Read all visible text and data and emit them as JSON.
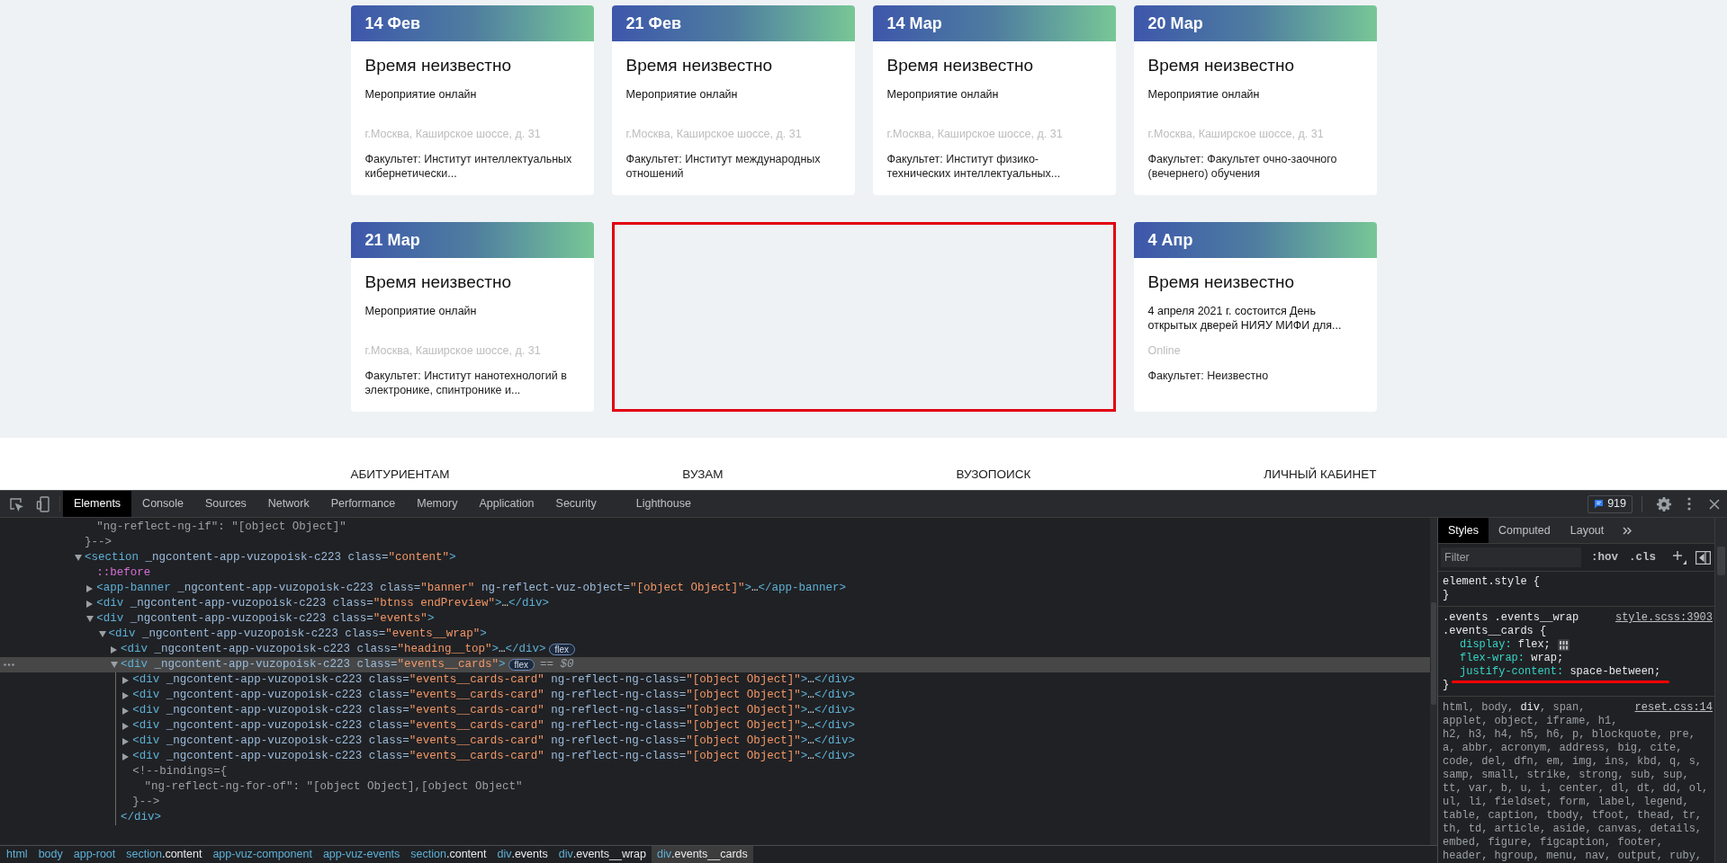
{
  "page": {
    "cards": [
      {
        "kind": "event",
        "date": "14 Фев",
        "time": "Время неизвестно",
        "description": "Мероприятие онлайн",
        "address": "г.Москва, Каширское шоссе, д. 31",
        "faculty": "Факультет: Институт интеллектуальных кибернетически..."
      },
      {
        "kind": "event",
        "date": "21 Фев",
        "time": "Время неизвестно",
        "description": "Мероприятие онлайн",
        "address": "г.Москва, Каширское шоссе, д. 31",
        "faculty": "Факультет: Институт международных отношений"
      },
      {
        "kind": "event",
        "date": "14 Мар",
        "time": "Время неизвестно",
        "description": "Мероприятие онлайн",
        "address": "г.Москва, Каширское шоссе, д. 31",
        "faculty": "Факультет: Институт физико-технических интеллектуальных..."
      },
      {
        "kind": "event",
        "date": "20 Мар",
        "time": "Время неизвестно",
        "description": "Мероприятие онлайн",
        "address": "г.Москва, Каширское шоссе, д. 31",
        "faculty": "Факультет: Факультет очно-заочного (вечернего) обучения"
      },
      {
        "kind": "event",
        "date": "21 Мар",
        "time": "Время неизвестно",
        "description": "Мероприятие онлайн",
        "address": "г.Москва, Каширское шоссе, д. 31",
        "faculty": "Факультет: Институт нанотехнологий в электронике, спинтронике и..."
      },
      {
        "kind": "highlight"
      },
      {
        "kind": "event",
        "date": "4 Апр",
        "time": "Время неизвестно",
        "description": "4 апреля 2021 г. состоится День открытых дверей НИЯУ МИФИ для...",
        "address": "Online",
        "faculty": "Факультет: Неизвестно"
      }
    ],
    "footer_nav": [
      "АБИТУРИЕНТАМ",
      "ВУЗАМ",
      "ВУЗОПОИСК",
      "ЛИЧНЫЙ КАБИНЕТ"
    ]
  },
  "devtools": {
    "tabs": [
      {
        "label": "Elements",
        "selected": true
      },
      {
        "label": "Console",
        "selected": false
      },
      {
        "label": "Sources",
        "selected": false
      },
      {
        "label": "Network",
        "selected": false
      },
      {
        "label": "Performance",
        "selected": false
      },
      {
        "label": "Memory",
        "selected": false
      },
      {
        "label": "Application",
        "selected": false
      },
      {
        "label": "Security",
        "selected": false
      },
      {
        "label": "Lighthouse",
        "selected": false
      }
    ],
    "issues_count": "919",
    "dom_tree": [
      {
        "kind": "comment-body",
        "selected": false,
        "tokens": [
          {
            "kind": "comment",
            "text": "\"ng-reflect-ng-if\": \"[object Object]\""
          }
        ]
      },
      {
        "kind": "comment",
        "selected": false,
        "tokens": [
          {
            "kind": "comment",
            "text": "}-->"
          }
        ]
      },
      {
        "kind": "element",
        "selected": false,
        "expanded": true,
        "tokens": [
          {
            "kind": "tag",
            "text": "<section"
          },
          {
            "kind": "attr",
            "text": " _ngcontent-app-vuzopoisk-c223 class="
          },
          {
            "kind": "value",
            "text": "\"content\""
          },
          {
            "kind": "tag",
            "text": ">"
          }
        ],
        "children": [
          {
            "kind": "pseudo",
            "selected": false,
            "tokens": [
              {
                "kind": "pseudo",
                "text": "::before"
              }
            ]
          },
          {
            "kind": "element",
            "selected": false,
            "expanded": false,
            "tokens": [
              {
                "kind": "tag",
                "text": "<app-banner"
              },
              {
                "kind": "attr",
                "text": " _ngcontent-app-vuzopoisk-c223 class="
              },
              {
                "kind": "value",
                "text": "\"banner\""
              },
              {
                "kind": "attr",
                "text": " ng-reflect-vuz-object="
              },
              {
                "kind": "value",
                "text": "\"[object Object]\""
              },
              {
                "kind": "tag",
                "text": ">"
              },
              {
                "kind": "ellipsis",
                "text": "…"
              },
              {
                "kind": "tag",
                "text": "</app-banner>"
              }
            ]
          },
          {
            "kind": "element",
            "selected": false,
            "expanded": false,
            "tokens": [
              {
                "kind": "tag",
                "text": "<div"
              },
              {
                "kind": "attr",
                "text": " _ngcontent-app-vuzopoisk-c223 class="
              },
              {
                "kind": "value",
                "text": "\"btnss endPreview\""
              },
              {
                "kind": "tag",
                "text": ">"
              },
              {
                "kind": "ellipsis",
                "text": "…"
              },
              {
                "kind": "tag",
                "text": "</div>"
              }
            ]
          },
          {
            "kind": "element",
            "selected": false,
            "expanded": true,
            "tokens": [
              {
                "kind": "tag",
                "text": "<div"
              },
              {
                "kind": "attr",
                "text": " _ngcontent-app-vuzopoisk-c223 class="
              },
              {
                "kind": "value",
                "text": "\"events\""
              },
              {
                "kind": "tag",
                "text": ">"
              }
            ],
            "children": [
              {
                "kind": "element",
                "selected": false,
                "expanded": true,
                "tokens": [
                  {
                    "kind": "tag",
                    "text": "<div"
                  },
                  {
                    "kind": "attr",
                    "text": " _ngcontent-app-vuzopoisk-c223 class="
                  },
                  {
                    "kind": "value",
                    "text": "\"events__wrap\""
                  },
                  {
                    "kind": "tag",
                    "text": ">"
                  }
                ],
                "children": [
                  {
                    "kind": "element",
                    "selected": false,
                    "expanded": false,
                    "badge": "flex",
                    "tokens": [
                      {
                        "kind": "tag",
                        "text": "<div"
                      },
                      {
                        "kind": "attr",
                        "text": " _ngcontent-app-vuzopoisk-c223 class="
                      },
                      {
                        "kind": "value",
                        "text": "\"heading__top\""
                      },
                      {
                        "kind": "tag",
                        "text": ">"
                      },
                      {
                        "kind": "ellipsis",
                        "text": "…"
                      },
                      {
                        "kind": "tag",
                        "text": "</div>"
                      }
                    ]
                  },
                  {
                    "kind": "element",
                    "selected": true,
                    "expanded": true,
                    "badge": "flex",
                    "note": "== $0",
                    "close": "</div>",
                    "tokens": [
                      {
                        "kind": "tag",
                        "text": "<div"
                      },
                      {
                        "kind": "attr",
                        "text": " _ngcontent-app-vuzopoisk-c223 class="
                      },
                      {
                        "kind": "value",
                        "text": "\"events__cards\""
                      },
                      {
                        "kind": "tag",
                        "text": ">"
                      }
                    ],
                    "children": [
                      {
                        "kind": "element",
                        "selected": false,
                        "expanded": false,
                        "tokens": [
                          {
                            "kind": "tag",
                            "text": "<div"
                          },
                          {
                            "kind": "attr",
                            "text": " _ngcontent-app-vuzopoisk-c223 class="
                          },
                          {
                            "kind": "value",
                            "text": "\"events__cards-card\""
                          },
                          {
                            "kind": "attr",
                            "text": " ng-reflect-ng-class="
                          },
                          {
                            "kind": "value",
                            "text": "\"[object Object]\""
                          },
                          {
                            "kind": "tag",
                            "text": ">"
                          },
                          {
                            "kind": "ellipsis",
                            "text": "…"
                          },
                          {
                            "kind": "tag",
                            "text": "</div>"
                          }
                        ]
                      },
                      {
                        "kind": "element",
                        "selected": false,
                        "expanded": false,
                        "tokens": [
                          {
                            "kind": "tag",
                            "text": "<div"
                          },
                          {
                            "kind": "attr",
                            "text": " _ngcontent-app-vuzopoisk-c223 class="
                          },
                          {
                            "kind": "value",
                            "text": "\"events__cards-card\""
                          },
                          {
                            "kind": "attr",
                            "text": " ng-reflect-ng-class="
                          },
                          {
                            "kind": "value",
                            "text": "\"[object Object]\""
                          },
                          {
                            "kind": "tag",
                            "text": ">"
                          },
                          {
                            "kind": "ellipsis",
                            "text": "…"
                          },
                          {
                            "kind": "tag",
                            "text": "</div>"
                          }
                        ]
                      },
                      {
                        "kind": "element",
                        "selected": false,
                        "expanded": false,
                        "tokens": [
                          {
                            "kind": "tag",
                            "text": "<div"
                          },
                          {
                            "kind": "attr",
                            "text": " _ngcontent-app-vuzopoisk-c223 class="
                          },
                          {
                            "kind": "value",
                            "text": "\"events__cards-card\""
                          },
                          {
                            "kind": "attr",
                            "text": " ng-reflect-ng-class="
                          },
                          {
                            "kind": "value",
                            "text": "\"[object Object]\""
                          },
                          {
                            "kind": "tag",
                            "text": ">"
                          },
                          {
                            "kind": "ellipsis",
                            "text": "…"
                          },
                          {
                            "kind": "tag",
                            "text": "</div>"
                          }
                        ]
                      },
                      {
                        "kind": "element",
                        "selected": false,
                        "expanded": false,
                        "tokens": [
                          {
                            "kind": "tag",
                            "text": "<div"
                          },
                          {
                            "kind": "attr",
                            "text": " _ngcontent-app-vuzopoisk-c223 class="
                          },
                          {
                            "kind": "value",
                            "text": "\"events__cards-card\""
                          },
                          {
                            "kind": "attr",
                            "text": " ng-reflect-ng-class="
                          },
                          {
                            "kind": "value",
                            "text": "\"[object Object]\""
                          },
                          {
                            "kind": "tag",
                            "text": ">"
                          },
                          {
                            "kind": "ellipsis",
                            "text": "…"
                          },
                          {
                            "kind": "tag",
                            "text": "</div>"
                          }
                        ]
                      },
                      {
                        "kind": "element",
                        "selected": false,
                        "expanded": false,
                        "tokens": [
                          {
                            "kind": "tag",
                            "text": "<div"
                          },
                          {
                            "kind": "attr",
                            "text": " _ngcontent-app-vuzopoisk-c223 class="
                          },
                          {
                            "kind": "value",
                            "text": "\"events__cards-card\""
                          },
                          {
                            "kind": "attr",
                            "text": " ng-reflect-ng-class="
                          },
                          {
                            "kind": "value",
                            "text": "\"[object Object]\""
                          },
                          {
                            "kind": "tag",
                            "text": ">"
                          },
                          {
                            "kind": "ellipsis",
                            "text": "…"
                          },
                          {
                            "kind": "tag",
                            "text": "</div>"
                          }
                        ]
                      },
                      {
                        "kind": "element",
                        "selected": false,
                        "expanded": false,
                        "tokens": [
                          {
                            "kind": "tag",
                            "text": "<div"
                          },
                          {
                            "kind": "attr",
                            "text": " _ngcontent-app-vuzopoisk-c223 class="
                          },
                          {
                            "kind": "value",
                            "text": "\"events__cards-card\""
                          },
                          {
                            "kind": "attr",
                            "text": " ng-reflect-ng-class="
                          },
                          {
                            "kind": "value",
                            "text": "\"[object Object]\""
                          },
                          {
                            "kind": "tag",
                            "text": ">"
                          },
                          {
                            "kind": "ellipsis",
                            "text": "…"
                          },
                          {
                            "kind": "tag",
                            "text": "</div>"
                          }
                        ]
                      },
                      {
                        "kind": "comment",
                        "selected": false,
                        "tokens": [
                          {
                            "kind": "comment",
                            "text": "<!--bindings={"
                          }
                        ]
                      },
                      {
                        "kind": "comment-body",
                        "selected": false,
                        "tokens": [
                          {
                            "kind": "comment",
                            "text": "\"ng-reflect-ng-for-of\": \"[object Object],[object Object\""
                          }
                        ]
                      },
                      {
                        "kind": "comment",
                        "selected": false,
                        "tokens": [
                          {
                            "kind": "comment",
                            "text": "}-->"
                          }
                        ]
                      }
                    ]
                  }
                ]
              }
            ]
          }
        ]
      }
    ],
    "breadcrumbs": [
      {
        "tag": "html",
        "selected": false
      },
      {
        "tag": "body",
        "selected": false
      },
      {
        "tag": "app-root",
        "selected": false
      },
      {
        "tag": "section",
        "cls": ".content",
        "selected": false
      },
      {
        "tag": "app-vuz-component",
        "selected": false
      },
      {
        "tag": "app-vuz-events",
        "selected": false
      },
      {
        "tag": "section",
        "cls": ".content",
        "selected": false
      },
      {
        "tag": "div",
        "cls": ".events",
        "selected": false
      },
      {
        "tag": "div",
        "cls": ".events__wrap",
        "selected": false
      },
      {
        "tag": "div",
        "cls": ".events__cards",
        "selected": true
      }
    ],
    "styles": {
      "tabs": [
        {
          "label": "Styles",
          "selected": true
        },
        {
          "label": "Computed",
          "selected": false
        },
        {
          "label": "Layout",
          "selected": false
        }
      ],
      "filter": {
        "placeholder": "Filter"
      },
      "toggles": [
        ":hov",
        ".cls"
      ],
      "rules": [
        {
          "kind": "inline",
          "selector_lines": [
            "element.style {"
          ],
          "close": "}"
        },
        {
          "kind": "matched",
          "selector_lines": [
            ".events .events__wrap",
            ".events__cards {"
          ],
          "source": "style.scss:3903",
          "close": "}",
          "declarations": [
            {
              "property": "display:",
              "value": "flex;",
              "flex_editor": true,
              "underlined": false
            },
            {
              "property": "flex-wrap:",
              "value": "wrap;",
              "flex_editor": false,
              "underlined": false
            },
            {
              "property": "justify-content:",
              "value": "space-between;",
              "flex_editor": false,
              "underlined": true
            }
          ]
        },
        {
          "kind": "inherited",
          "source": "reset.css:14",
          "selector_lines": [
            "html, body, **div**, span,",
            "applet, object, iframe, h1,",
            "h2, h3, h4, h5, h6, p, blockquote, pre,",
            "a, abbr, acronym, address, big, cite,",
            "code, del, dfn, em, img, ins, kbd, q, s,",
            "samp, small, strike, strong, sub, sup,",
            "tt, var, b, u, i, center, dl, dt, dd, ol,",
            "ul, li, fieldset, form, label, legend,",
            "table, caption, tbody, tfoot, thead, tr,",
            "th, td, article, aside, canvas, details,",
            "embed, figure, figcaption, footer,",
            "header, hgroup, menu, nav, output, ruby,"
          ]
        }
      ]
    }
  }
}
